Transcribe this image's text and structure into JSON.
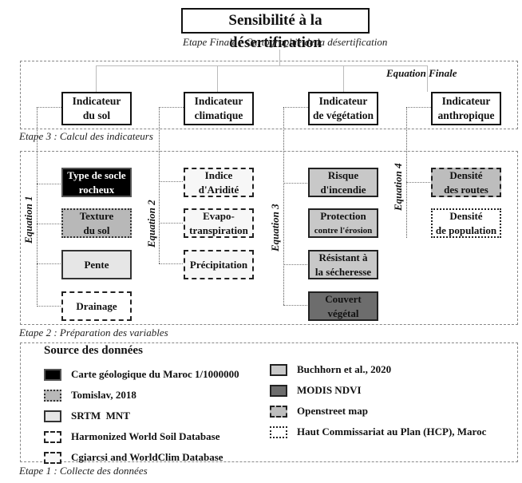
{
  "title": "Sensibilité à la désertification",
  "stages": {
    "final": "Etape Finale : Cartographie de la désertification",
    "stage3": "Etape 3 : Calcul des indicateurs",
    "stage2": "Etape 2 : Préparation des variables",
    "stage1": "Etape 1 : Collecte des données"
  },
  "equation_final": "Equation Finale",
  "indicators": [
    {
      "line1": "Indicateur",
      "line2": "du sol"
    },
    {
      "line1": "Indicateur",
      "line2": "climatique"
    },
    {
      "line1": "Indicateur",
      "line2": "de végétation"
    },
    {
      "line1": "Indicateur",
      "line2": "anthropique"
    }
  ],
  "equations": [
    "Equation 1",
    "Equation 2",
    "Equation 3",
    "Equation 4"
  ],
  "variables": {
    "sol": [
      {
        "line1": "Type de socle",
        "line2": "rocheux",
        "style": "solid-black"
      },
      {
        "line1": "Texture",
        "line2": "du sol",
        "style": "dotted-gray"
      },
      {
        "line1": "Pente",
        "line2": "",
        "style": "solid-light"
      },
      {
        "line1": "Drainage",
        "line2": "",
        "style": "dashed-white"
      }
    ],
    "climat": [
      {
        "line1": "Indice",
        "line2": "d'Aridité",
        "style": "dashed-light"
      },
      {
        "line1": "Evapo-",
        "line2": "transpiration",
        "style": "dashed-light"
      },
      {
        "line1": "Précipitation",
        "line2": "",
        "style": "dashed-light"
      }
    ],
    "vegetation": [
      {
        "line1": "Risque",
        "line2": "d'incendie",
        "style": "solid-gray"
      },
      {
        "line1": "Protection",
        "line2": "contre l'érosion",
        "style": "solid-gray"
      },
      {
        "line1": "Résistant à",
        "line2": "la sécheresse",
        "style": "solid-gray"
      },
      {
        "line1": "Couvert",
        "line2": "végétal",
        "style": "solid-dark"
      }
    ],
    "anthropique": [
      {
        "line1": "Densité",
        "line2": "des routes",
        "style": "dashed-gray"
      },
      {
        "line1": "Densité",
        "line2": "de population",
        "style": "dotted-white"
      }
    ]
  },
  "legend": {
    "title": "Source des données",
    "left": [
      {
        "label": "Carte géologique du Maroc 1/1000000",
        "style": "solid-black"
      },
      {
        "label": "Tomislav, 2018",
        "style": "dotted-gray"
      },
      {
        "label": "SRTM  MNT",
        "style": "solid-light"
      },
      {
        "label": "Harmonized World Soil Database",
        "style": "dashed-white"
      },
      {
        "label": "Cgiarcsi and WorldClim Database",
        "style": "dashed-light"
      }
    ],
    "right": [
      {
        "label": "Buchhorn et al., 2020",
        "style": "solid-gray"
      },
      {
        "label": "MODIS NDVI",
        "style": "solid-dark"
      },
      {
        "label": "Openstreet map",
        "style": "dashed-gray"
      },
      {
        "label": "Haut Commissariat au Plan (HCP), Maroc",
        "style": "dotted-white"
      }
    ]
  }
}
